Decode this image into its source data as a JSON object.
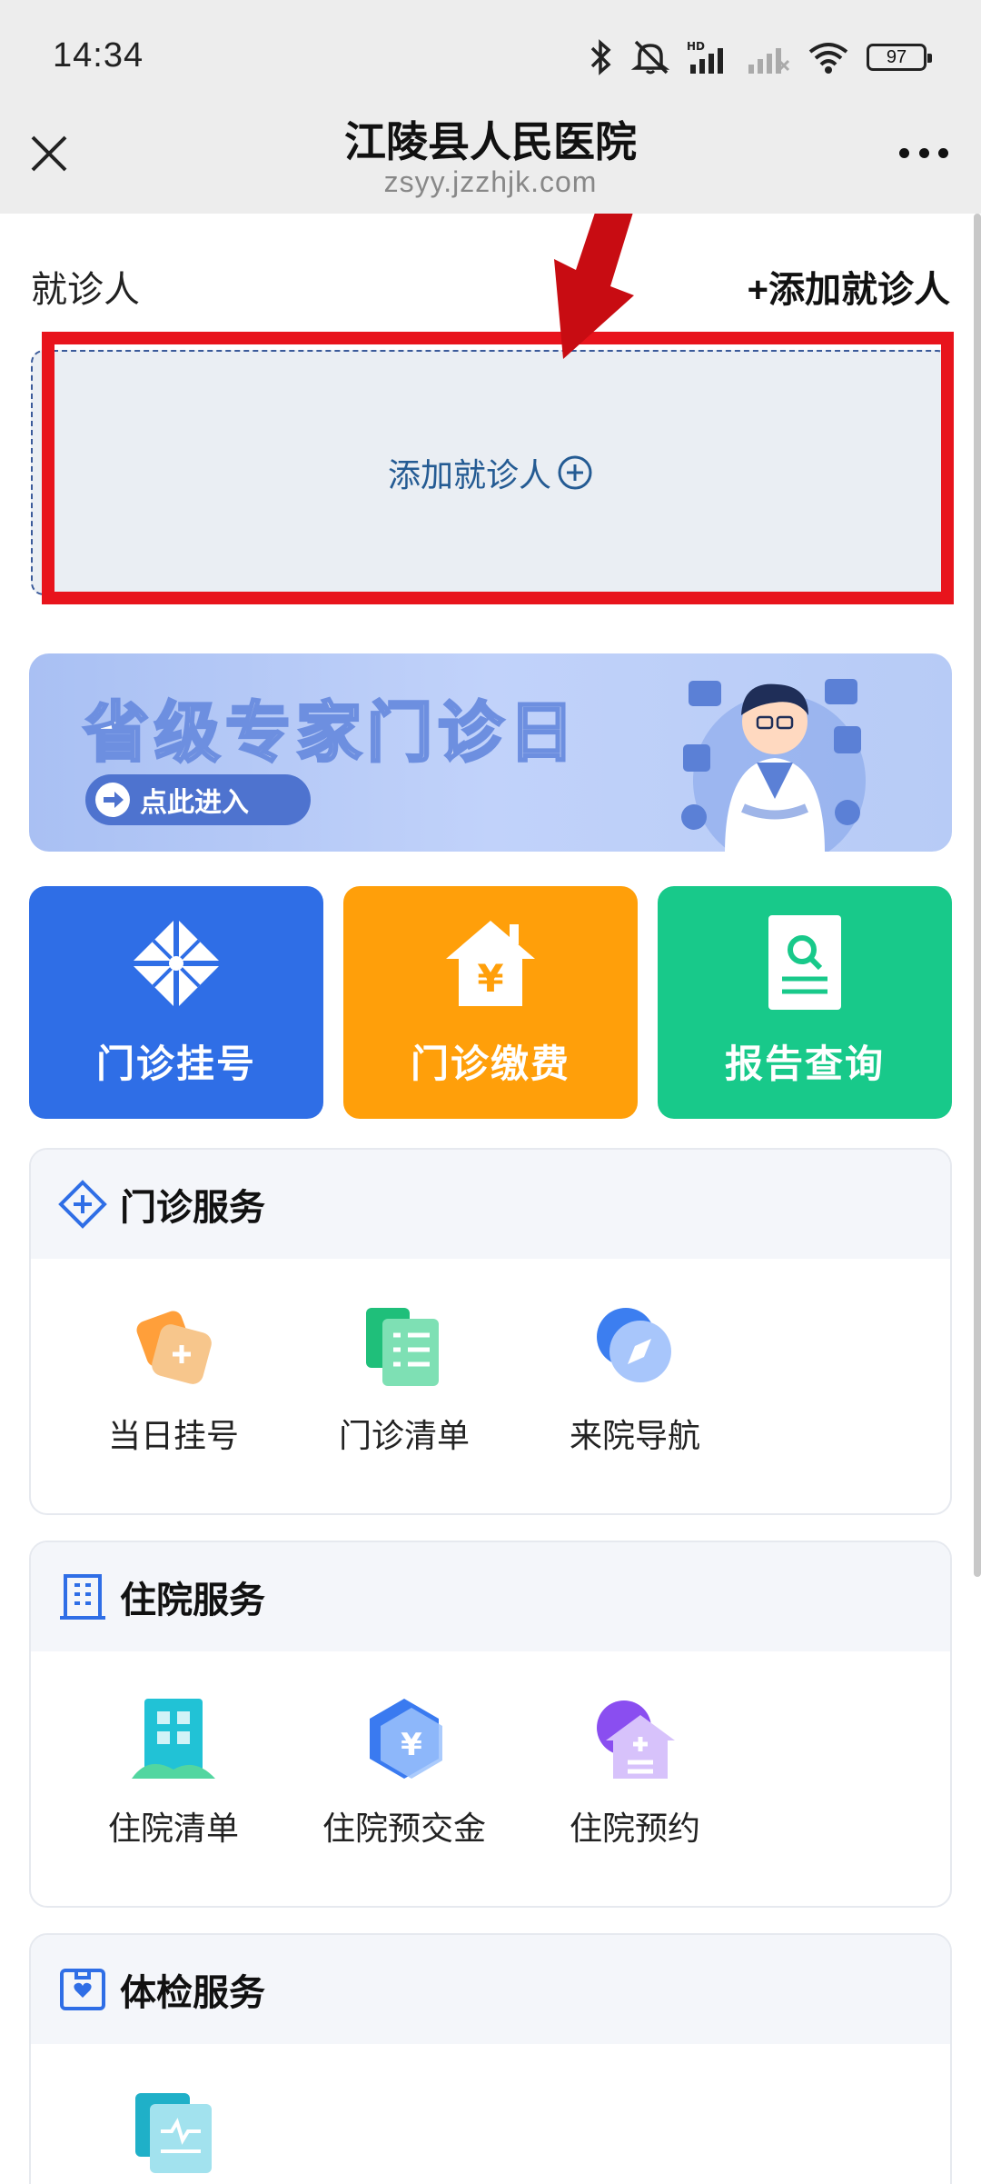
{
  "status_bar": {
    "time": "14:34",
    "battery": "97",
    "icons": [
      "bluetooth-icon",
      "mute-icon",
      "hd-signal-icon",
      "signal-icon",
      "wifi-icon",
      "battery-icon"
    ]
  },
  "nav": {
    "title": "江陵县人民医院",
    "url": "zsyy.jzzhjk.com",
    "close_icon": "close-icon",
    "more_icon": "more-icon"
  },
  "patient": {
    "label": "就诊人",
    "add_link": "+添加就诊人",
    "add_box_text": "添加就诊人"
  },
  "annotation": {
    "highlight_color": "#e8141c"
  },
  "banner": {
    "title": "省级专家门诊日",
    "button": "点此进入"
  },
  "tiles": [
    {
      "label": "门诊挂号",
      "color": "#2f6ee6",
      "icon": "registration-icon"
    },
    {
      "label": "门诊缴费",
      "color": "#ff9f0a",
      "icon": "payment-house-icon"
    },
    {
      "label": "报告查询",
      "color": "#18c98a",
      "icon": "report-search-icon"
    }
  ],
  "sections": [
    {
      "title": "门诊服务",
      "icon": "outpatient-icon",
      "items": [
        {
          "label": "当日挂号",
          "icon": "same-day-registration-icon"
        },
        {
          "label": "门诊清单",
          "icon": "outpatient-list-icon"
        },
        {
          "label": "来院导航",
          "icon": "navigation-compass-icon"
        }
      ]
    },
    {
      "title": "住院服务",
      "icon": "building-icon",
      "items": [
        {
          "label": "住院清单",
          "icon": "inpatient-list-icon"
        },
        {
          "label": "住院预交金",
          "icon": "deposit-icon"
        },
        {
          "label": "住院预约",
          "icon": "inpatient-booking-icon"
        }
      ]
    },
    {
      "title": "体检服务",
      "icon": "checkup-icon",
      "items": [
        {
          "label": "",
          "icon": "checkup-report-icon"
        }
      ]
    }
  ]
}
